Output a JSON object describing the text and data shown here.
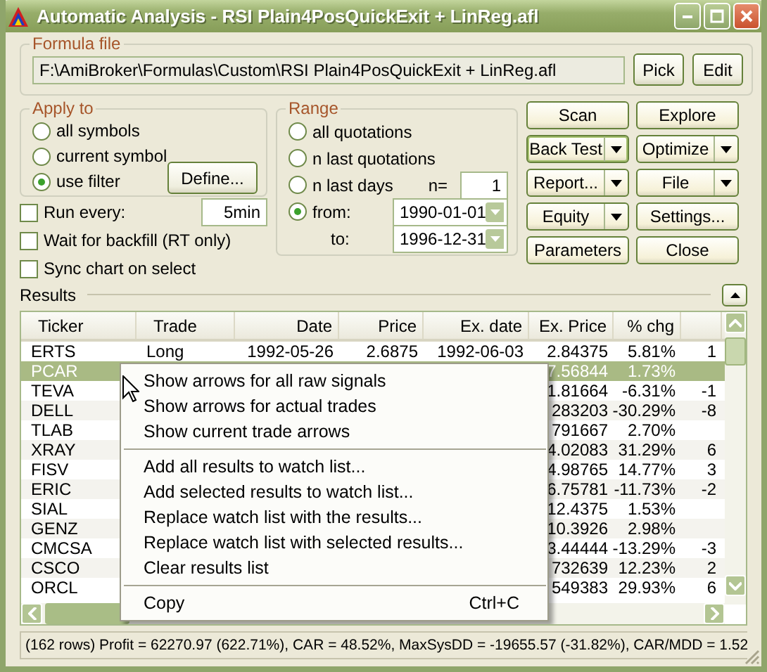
{
  "window": {
    "title": "Automatic Analysis - RSI Plain4PosQuickExit + LinReg.afl"
  },
  "formula_file": {
    "label": "Formula file",
    "value": "F:\\AmiBroker\\Formulas\\Custom\\RSI Plain4PosQuickExit + LinReg.afl",
    "buttons": [
      "Pick",
      "Edit"
    ]
  },
  "apply_to": {
    "label": "Apply to",
    "options": [
      {
        "label": "all symbols",
        "selected": false
      },
      {
        "label": "current symbol",
        "selected": false
      },
      {
        "label": "use filter",
        "selected": true
      }
    ],
    "define_button": "Define..."
  },
  "run_every": {
    "label": "Run every:",
    "checked": false,
    "value": "5min"
  },
  "wait_for_backfill": {
    "label": "Wait for backfill (RT only)",
    "checked": false
  },
  "sync_chart": {
    "label": "Sync chart on select",
    "checked": false
  },
  "range": {
    "label": "Range",
    "options": [
      {
        "label": "all quotations",
        "selected": false
      },
      {
        "label": "n last quotations",
        "selected": false
      },
      {
        "label": "n last days",
        "selected": false
      },
      {
        "label": "from:",
        "selected": true
      }
    ],
    "n_label": "n=",
    "n_value": "1",
    "from_value": "1990-01-01",
    "to_label": "to:",
    "to_value": "1996-12-31"
  },
  "action_buttons": [
    {
      "label": "Scan",
      "dropdown": false,
      "default": false
    },
    {
      "label": "Explore",
      "dropdown": false,
      "default": false
    },
    {
      "label": "Back Test",
      "dropdown": true,
      "default": true
    },
    {
      "label": "Optimize",
      "dropdown": true,
      "default": false
    },
    {
      "label": "Report...",
      "dropdown": true,
      "default": false
    },
    {
      "label": "File",
      "dropdown": true,
      "default": false
    },
    {
      "label": "Equity",
      "dropdown": true,
      "default": false
    },
    {
      "label": "Settings...",
      "dropdown": false,
      "default": false
    },
    {
      "label": "Parameters",
      "dropdown": false,
      "default": false
    },
    {
      "label": "Close",
      "dropdown": false,
      "default": false
    }
  ],
  "results": {
    "label": "Results",
    "table": {
      "columns": [
        "Ticker",
        "Trade",
        "Date",
        "Price",
        "Ex. date",
        "Ex. Price",
        "% chg"
      ],
      "rows": [
        {
          "cells": [
            "ERTS",
            "Long",
            "1992-05-26",
            "2.6875",
            "1992-06-03",
            "2.84375",
            "5.81%",
            "1"
          ],
          "selected": false
        },
        {
          "cells": [
            "PCAR",
            null,
            null,
            null,
            null,
            "7.56844",
            "1.73%",
            null
          ],
          "selected": true
        },
        {
          "cells": [
            "TEVA",
            null,
            null,
            null,
            null,
            "1.81664",
            "-6.31%",
            "-1"
          ],
          "selected": false
        },
        {
          "cells": [
            "DELL",
            null,
            null,
            null,
            null,
            "283203",
            "-30.29%",
            "-8"
          ],
          "selected": false
        },
        {
          "cells": [
            "TLAB",
            null,
            null,
            null,
            null,
            "791667",
            "2.70%",
            null
          ],
          "selected": false
        },
        {
          "cells": [
            "XRAY",
            null,
            null,
            null,
            null,
            "4.02083",
            "31.29%",
            "6"
          ],
          "selected": false
        },
        {
          "cells": [
            "FISV",
            null,
            null,
            null,
            null,
            "4.98765",
            "14.77%",
            "3"
          ],
          "selected": false
        },
        {
          "cells": [
            "ERIC",
            null,
            null,
            null,
            null,
            "6.75781",
            "-11.73%",
            "-2"
          ],
          "selected": false
        },
        {
          "cells": [
            "SIAL",
            null,
            null,
            null,
            null,
            "12.4375",
            "1.53%",
            null
          ],
          "selected": false
        },
        {
          "cells": [
            "GENZ",
            null,
            null,
            null,
            null,
            "10.3926",
            "2.98%",
            null
          ],
          "selected": false
        },
        {
          "cells": [
            "CMCSA",
            null,
            null,
            null,
            null,
            "3.44444",
            "-13.29%",
            "-3"
          ],
          "selected": false
        },
        {
          "cells": [
            "CSCO",
            null,
            null,
            null,
            null,
            "732639",
            "12.23%",
            "2"
          ],
          "selected": false
        },
        {
          "cells": [
            "ORCL",
            null,
            null,
            null,
            null,
            "549383",
            "29.93%",
            "6"
          ],
          "selected": false
        }
      ]
    }
  },
  "context_menu": [
    {
      "kind": "item",
      "label": "Show arrows for all raw signals"
    },
    {
      "kind": "item",
      "label": "Show arrows for actual trades"
    },
    {
      "kind": "item",
      "label": "Show current trade arrows"
    },
    {
      "kind": "separator"
    },
    {
      "kind": "item",
      "label": "Add all results to watch list..."
    },
    {
      "kind": "item",
      "label": "Add selected results to watch list..."
    },
    {
      "kind": "item",
      "label": "Replace watch list with the results..."
    },
    {
      "kind": "item",
      "label": "Replace watch list with selected results..."
    },
    {
      "kind": "item",
      "label": "Clear results list"
    },
    {
      "kind": "separator"
    },
    {
      "kind": "item",
      "label": "Copy",
      "shortcut": "Ctrl+C"
    }
  ],
  "status_bar": "(162 rows) Profit = 62270.97 (622.71%), CAR = 48.52%, MaxSysDD = -19655.57 (-31.82%), CAR/MDD = 1.52"
}
